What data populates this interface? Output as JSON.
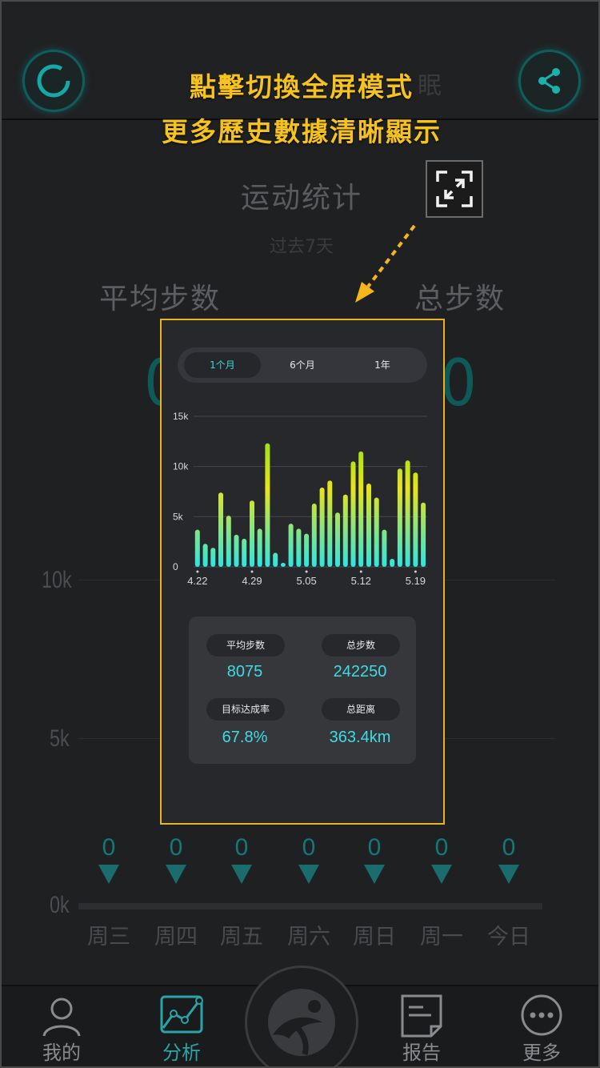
{
  "header": {
    "dim_text": "眠"
  },
  "overlay": {
    "title_line1": "點擊切換全屏模式",
    "title_line2": "更多歷史數據清晰顯示"
  },
  "background": {
    "title": "运动统计",
    "subtitle": "过去7天",
    "avg_label": "平均步数",
    "total_label": "总步数",
    "avg_value": "0",
    "total_value": "0",
    "y_axis": [
      "10k",
      "5k",
      "0k"
    ],
    "days": [
      "周三",
      "周四",
      "周五",
      "周六",
      "周日",
      "周一",
      "今日"
    ],
    "day_values": [
      "0",
      "0",
      "0",
      "0",
      "0",
      "0",
      "0"
    ]
  },
  "phone": {
    "tabs": [
      "1个月",
      "6个月",
      "1年"
    ],
    "active_tab": 0,
    "stats": {
      "avg_label": "平均步数",
      "avg_value": "8075",
      "total_label": "总步数",
      "total_value": "242250",
      "goal_label": "目标达成率",
      "goal_value": "67.8%",
      "distance_label": "总距离",
      "distance_value": "363.4km"
    }
  },
  "chart_data": {
    "type": "bar",
    "yticks": [
      "15k",
      "10k",
      "5k",
      "0"
    ],
    "ylim": [
      0,
      15000
    ],
    "xticks": [
      "4.22",
      "4.29",
      "5.05",
      "5.12",
      "5.19"
    ],
    "colors": {
      "low": "#2ee6e0",
      "high": "#7be21c",
      "top": "#e8e41a"
    },
    "values": [
      3700,
      2300,
      1900,
      7400,
      5100,
      3200,
      2800,
      6600,
      3800,
      12300,
      1400,
      400,
      4300,
      3800,
      3300,
      6300,
      7900,
      8600,
      5400,
      7200,
      10500,
      11500,
      8300,
      6900,
      3700,
      800,
      9800,
      10600,
      9400,
      6400
    ]
  },
  "tabbar": {
    "items": [
      "我的",
      "分析",
      "报告",
      "更多"
    ],
    "active": 1
  },
  "colors": {
    "accent": "#3ad7de",
    "highlight": "#f6c21c",
    "active_tab": "#2aa4a8"
  }
}
